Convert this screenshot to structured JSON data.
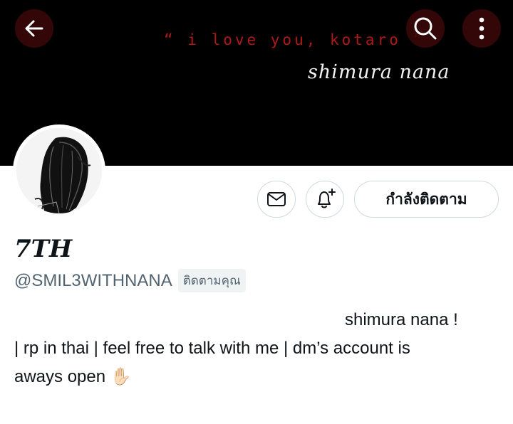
{
  "banner": {
    "quote": "“ i love you, kotaro ”",
    "signature": "shimura nana"
  },
  "profile": {
    "display_name": "7TH",
    "handle": "@SMIL3WITHNANA",
    "follows_you_badge": "ติดตามคุณ",
    "bio_lines": [
      "shimura nana !",
      "| rp in thai | feel free to talk with me | dm’s account is",
      "aways open ✋🏻"
    ]
  },
  "actions": {
    "message_icon": "mail-icon",
    "notify_icon": "bell-plus-icon",
    "follow_label": "กำลังติดตาม"
  },
  "toolbar": {
    "back_icon": "arrow-left-icon",
    "search_icon": "search-icon",
    "more_icon": "more-vertical-icon"
  }
}
